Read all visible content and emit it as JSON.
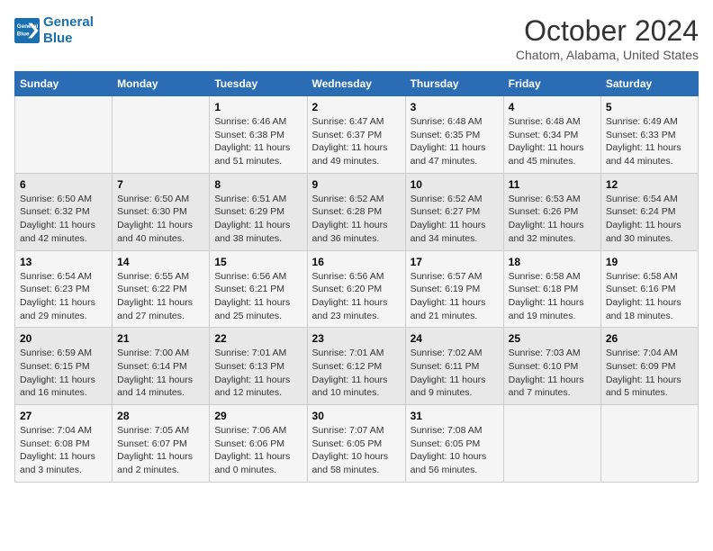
{
  "header": {
    "logo_line1": "General",
    "logo_line2": "Blue",
    "title": "October 2024",
    "subtitle": "Chatom, Alabama, United States"
  },
  "days_of_week": [
    "Sunday",
    "Monday",
    "Tuesday",
    "Wednesday",
    "Thursday",
    "Friday",
    "Saturday"
  ],
  "weeks": [
    [
      {
        "day": "",
        "detail": ""
      },
      {
        "day": "",
        "detail": ""
      },
      {
        "day": "1",
        "detail": "Sunrise: 6:46 AM\nSunset: 6:38 PM\nDaylight: 11 hours\nand 51 minutes."
      },
      {
        "day": "2",
        "detail": "Sunrise: 6:47 AM\nSunset: 6:37 PM\nDaylight: 11 hours\nand 49 minutes."
      },
      {
        "day": "3",
        "detail": "Sunrise: 6:48 AM\nSunset: 6:35 PM\nDaylight: 11 hours\nand 47 minutes."
      },
      {
        "day": "4",
        "detail": "Sunrise: 6:48 AM\nSunset: 6:34 PM\nDaylight: 11 hours\nand 45 minutes."
      },
      {
        "day": "5",
        "detail": "Sunrise: 6:49 AM\nSunset: 6:33 PM\nDaylight: 11 hours\nand 44 minutes."
      }
    ],
    [
      {
        "day": "6",
        "detail": "Sunrise: 6:50 AM\nSunset: 6:32 PM\nDaylight: 11 hours\nand 42 minutes."
      },
      {
        "day": "7",
        "detail": "Sunrise: 6:50 AM\nSunset: 6:30 PM\nDaylight: 11 hours\nand 40 minutes."
      },
      {
        "day": "8",
        "detail": "Sunrise: 6:51 AM\nSunset: 6:29 PM\nDaylight: 11 hours\nand 38 minutes."
      },
      {
        "day": "9",
        "detail": "Sunrise: 6:52 AM\nSunset: 6:28 PM\nDaylight: 11 hours\nand 36 minutes."
      },
      {
        "day": "10",
        "detail": "Sunrise: 6:52 AM\nSunset: 6:27 PM\nDaylight: 11 hours\nand 34 minutes."
      },
      {
        "day": "11",
        "detail": "Sunrise: 6:53 AM\nSunset: 6:26 PM\nDaylight: 11 hours\nand 32 minutes."
      },
      {
        "day": "12",
        "detail": "Sunrise: 6:54 AM\nSunset: 6:24 PM\nDaylight: 11 hours\nand 30 minutes."
      }
    ],
    [
      {
        "day": "13",
        "detail": "Sunrise: 6:54 AM\nSunset: 6:23 PM\nDaylight: 11 hours\nand 29 minutes."
      },
      {
        "day": "14",
        "detail": "Sunrise: 6:55 AM\nSunset: 6:22 PM\nDaylight: 11 hours\nand 27 minutes."
      },
      {
        "day": "15",
        "detail": "Sunrise: 6:56 AM\nSunset: 6:21 PM\nDaylight: 11 hours\nand 25 minutes."
      },
      {
        "day": "16",
        "detail": "Sunrise: 6:56 AM\nSunset: 6:20 PM\nDaylight: 11 hours\nand 23 minutes."
      },
      {
        "day": "17",
        "detail": "Sunrise: 6:57 AM\nSunset: 6:19 PM\nDaylight: 11 hours\nand 21 minutes."
      },
      {
        "day": "18",
        "detail": "Sunrise: 6:58 AM\nSunset: 6:18 PM\nDaylight: 11 hours\nand 19 minutes."
      },
      {
        "day": "19",
        "detail": "Sunrise: 6:58 AM\nSunset: 6:16 PM\nDaylight: 11 hours\nand 18 minutes."
      }
    ],
    [
      {
        "day": "20",
        "detail": "Sunrise: 6:59 AM\nSunset: 6:15 PM\nDaylight: 11 hours\nand 16 minutes."
      },
      {
        "day": "21",
        "detail": "Sunrise: 7:00 AM\nSunset: 6:14 PM\nDaylight: 11 hours\nand 14 minutes."
      },
      {
        "day": "22",
        "detail": "Sunrise: 7:01 AM\nSunset: 6:13 PM\nDaylight: 11 hours\nand 12 minutes."
      },
      {
        "day": "23",
        "detail": "Sunrise: 7:01 AM\nSunset: 6:12 PM\nDaylight: 11 hours\nand 10 minutes."
      },
      {
        "day": "24",
        "detail": "Sunrise: 7:02 AM\nSunset: 6:11 PM\nDaylight: 11 hours\nand 9 minutes."
      },
      {
        "day": "25",
        "detail": "Sunrise: 7:03 AM\nSunset: 6:10 PM\nDaylight: 11 hours\nand 7 minutes."
      },
      {
        "day": "26",
        "detail": "Sunrise: 7:04 AM\nSunset: 6:09 PM\nDaylight: 11 hours\nand 5 minutes."
      }
    ],
    [
      {
        "day": "27",
        "detail": "Sunrise: 7:04 AM\nSunset: 6:08 PM\nDaylight: 11 hours\nand 3 minutes."
      },
      {
        "day": "28",
        "detail": "Sunrise: 7:05 AM\nSunset: 6:07 PM\nDaylight: 11 hours\nand 2 minutes."
      },
      {
        "day": "29",
        "detail": "Sunrise: 7:06 AM\nSunset: 6:06 PM\nDaylight: 11 hours\nand 0 minutes."
      },
      {
        "day": "30",
        "detail": "Sunrise: 7:07 AM\nSunset: 6:05 PM\nDaylight: 10 hours\nand 58 minutes."
      },
      {
        "day": "31",
        "detail": "Sunrise: 7:08 AM\nSunset: 6:05 PM\nDaylight: 10 hours\nand 56 minutes."
      },
      {
        "day": "",
        "detail": ""
      },
      {
        "day": "",
        "detail": ""
      }
    ]
  ]
}
